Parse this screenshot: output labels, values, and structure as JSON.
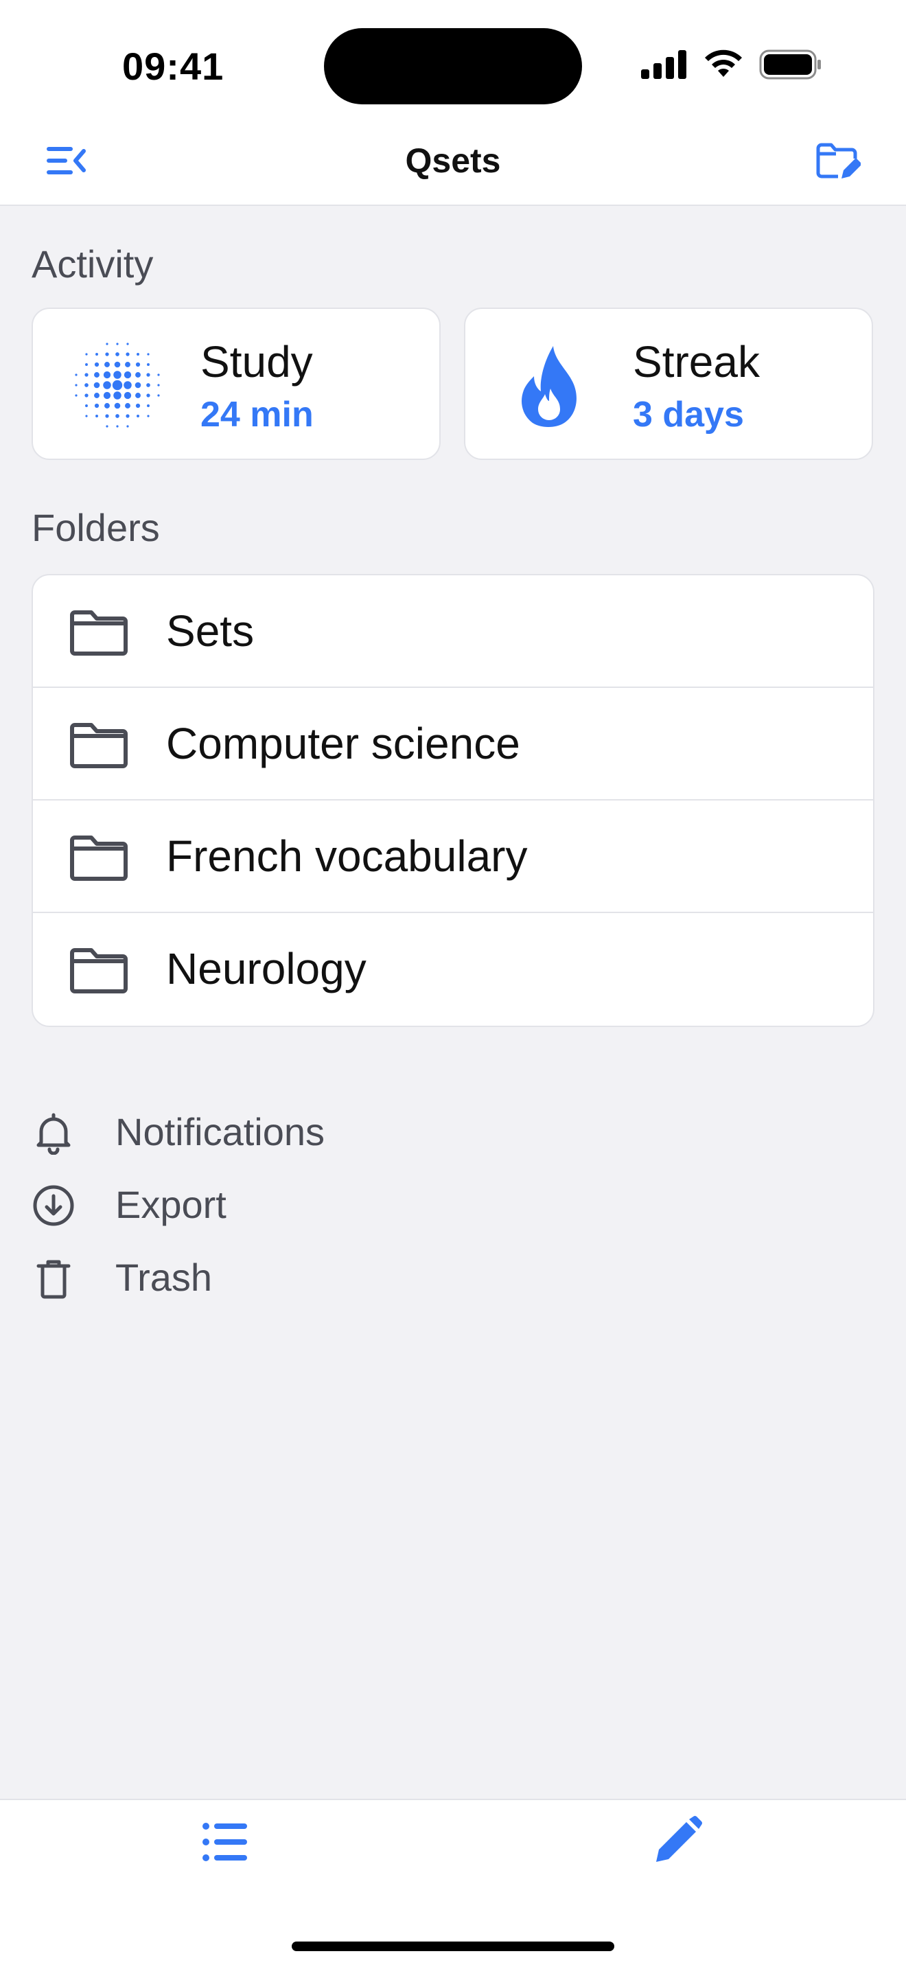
{
  "status_bar": {
    "time": "09:41"
  },
  "nav": {
    "title": "Qsets",
    "left_icon": "sidebar-collapse-icon",
    "right_icon": "folder-edit-icon"
  },
  "sections": {
    "activity_label": "Activity",
    "folders_label": "Folders"
  },
  "activity": [
    {
      "title": "Study",
      "value": "24 min",
      "icon": "halftone-dots-icon"
    },
    {
      "title": "Streak",
      "value": "3 days",
      "icon": "flame-icon"
    }
  ],
  "folders": [
    {
      "label": "Sets",
      "icon": "folder-icon"
    },
    {
      "label": "Computer science",
      "icon": "folder-icon"
    },
    {
      "label": "French vocabulary",
      "icon": "folder-icon"
    },
    {
      "label": "Neurology",
      "icon": "folder-icon"
    }
  ],
  "utility": [
    {
      "label": "Notifications",
      "icon": "bell-icon"
    },
    {
      "label": "Export",
      "icon": "download-circle-icon"
    },
    {
      "label": "Trash",
      "icon": "trash-icon"
    }
  ],
  "tab_bar": {
    "left_icon": "list-icon",
    "right_icon": "pencil-icon"
  },
  "colors": {
    "accent": "#3478F6",
    "background": "#F2F2F5",
    "card": "#FFFFFF",
    "icon_gray": "#4A4C55"
  }
}
